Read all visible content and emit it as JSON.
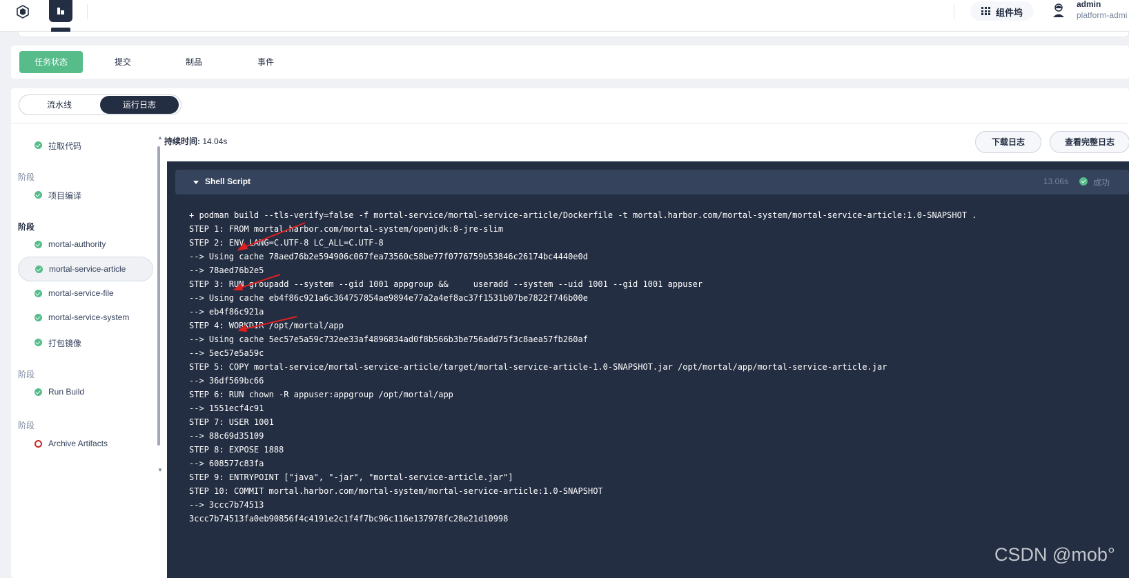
{
  "topbar": {
    "workbench_label": "组件坞",
    "user_name": "admin",
    "user_role": "platform-admi"
  },
  "tabs": [
    "任务状态",
    "提交",
    "制品",
    "事件"
  ],
  "active_tab": "任务状态",
  "view_toggle": {
    "options": [
      "流水线",
      "运行日志"
    ],
    "selected": "运行日志"
  },
  "sidebar": {
    "stage_label": "阶段",
    "items": [
      {
        "label": "拉取代码",
        "status": "success"
      },
      {
        "label": "项目编译",
        "status": "success"
      },
      {
        "label": "mortal-authority",
        "status": "success"
      },
      {
        "label": "mortal-service-article",
        "status": "success",
        "selected": true
      },
      {
        "label": "mortal-service-file",
        "status": "success"
      },
      {
        "label": "mortal-service-system",
        "status": "success"
      },
      {
        "label": "打包镜像",
        "status": "success"
      },
      {
        "label": "Run Build",
        "status": "success"
      },
      {
        "label": "Archive Artifacts",
        "status": "failed"
      }
    ]
  },
  "duration": {
    "label": "持续时间:",
    "value": "14.04s"
  },
  "buttons": {
    "download": "下载日志",
    "full_log": "查看完整日志"
  },
  "log": {
    "step_title": "Shell Script",
    "time": "13.06s",
    "status": "成功",
    "lines": [
      "+ podman build --tls-verify=false -f mortal-service/mortal-service-article/Dockerfile -t mortal.harbor.com/mortal-system/mortal-service-article:1.0-SNAPSHOT .",
      "STEP 1: FROM mortal.harbor.com/mortal-system/openjdk:8-jre-slim",
      "STEP 2: ENV LANG=C.UTF-8 LC_ALL=C.UTF-8",
      "--> Using cache 78aed76b2e594906c067fea73560c58be77f0776759b53846c26174bc4440e0d",
      "--> 78aed76b2e5",
      "STEP 3: RUN groupadd --system --gid 1001 appgroup &&     useradd --system --uid 1001 --gid 1001 appuser",
      "--> Using cache eb4f86c921a6c364757854ae9894e77a2a4ef8ac37f1531b07be7822f746b00e",
      "--> eb4f86c921a",
      "STEP 4: WORKDIR /opt/mortal/app",
      "--> Using cache 5ec57e5a59c732ee33af4896834ad0f8b566b3be756add75f3c8aea57fb260af",
      "--> 5ec57e5a59c",
      "STEP 5: COPY mortal-service/mortal-service-article/target/mortal-service-article-1.0-SNAPSHOT.jar /opt/mortal/app/mortal-service-article.jar",
      "--> 36df569bc66",
      "STEP 6: RUN chown -R appuser:appgroup /opt/mortal/app",
      "--> 1551ecf4c91",
      "STEP 7: USER 1001",
      "--> 88c69d35109",
      "STEP 8: EXPOSE 1888",
      "--> 608577c83fa",
      "STEP 9: ENTRYPOINT [\"java\", \"-jar\", \"mortal-service-article.jar\"]",
      "STEP 10: COMMIT mortal.harbor.com/mortal-system/mortal-service-article:1.0-SNAPSHOT",
      "--> 3ccc7b74513",
      "3ccc7b74513fa0eb90856f4c4191e2c1f4f7bc96c116e137978fc28e21d10998"
    ]
  },
  "watermark": "CSDN @mob°",
  "colors": {
    "accent_green": "#55bc8a",
    "dark_navy": "#242e42",
    "log_header": "#36435c",
    "fail_red": "#ca2621",
    "annotation_red": "#e02020"
  }
}
